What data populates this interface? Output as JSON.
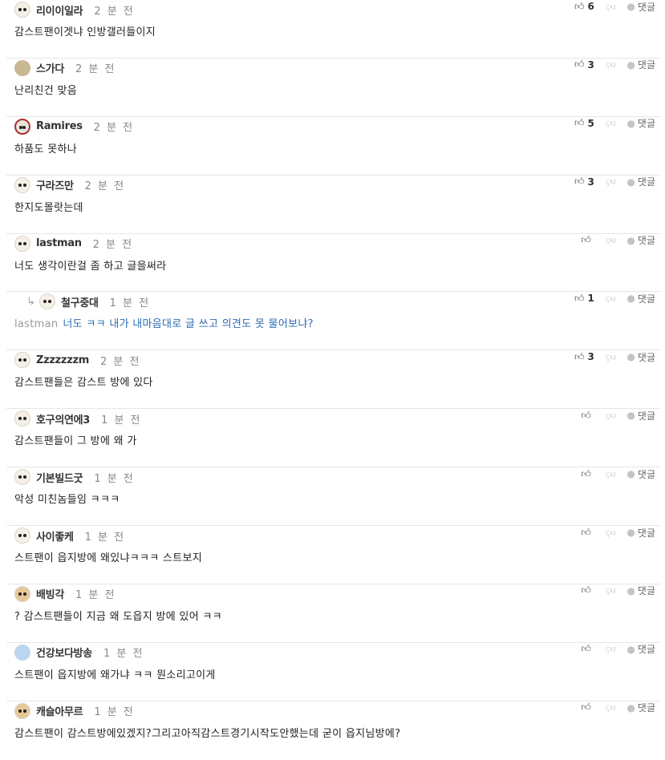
{
  "comments": [
    {
      "nick": "리이이일라",
      "time": "2 분 전",
      "text": "감스트팬이겟냐 인방갤러들이지",
      "likes": "6",
      "avatar": "dog-icon"
    },
    {
      "nick": "스가다",
      "time": "2 분 전",
      "text": "난리친건 맞음",
      "likes": "3",
      "avatar": "blob-icon"
    },
    {
      "nick": "Ramires",
      "time": "2 분 전",
      "text": "하품도 못하나",
      "likes": "5",
      "avatar": "red-dog-icon"
    },
    {
      "nick": "구라즈만",
      "time": "2 분 전",
      "text": "한지도몰랏는데",
      "likes": "3",
      "avatar": "dog-icon"
    },
    {
      "nick": "lastman",
      "time": "2 분 전",
      "text": "너도 생각이란걸 좀 하고 글을써라",
      "likes": "",
      "avatar": "dog-icon"
    },
    {
      "nick": "철구중대",
      "time": "1 분 전",
      "mention": "lastman",
      "text": "너도 ㅋㅋ 내가 내마음대로 글 쓰고 의견도 못 물어보냐?",
      "likes": "1",
      "avatar": "dog-icon",
      "reply": true
    },
    {
      "nick": "Zzzzzzzm",
      "time": "2 분 전",
      "text": "감스트팬들은 감스트 방에 있다",
      "likes": "3",
      "avatar": "dog-icon"
    },
    {
      "nick": "호구의연에3",
      "time": "1 분 전",
      "text": "감스트팬들이 그 방에 왜 가",
      "likes": "",
      "avatar": "dog-icon"
    },
    {
      "nick": "기본빌드굿",
      "time": "1 분 전",
      "text": "악성 미친놈들임 ㅋㅋㅋ",
      "likes": "",
      "avatar": "dog-icon"
    },
    {
      "nick": "사이좋케",
      "time": "1 분 전",
      "text": "스트팬이 읍지방에 왜있냐ㅋㅋㅋ 스트보지",
      "likes": "",
      "avatar": "dog-icon"
    },
    {
      "nick": "배빙각",
      "time": "1 분 전",
      "text": "? 감스트팬들이 지금 왜 도읍지 방에 있어 ㅋㅋ",
      "likes": "",
      "avatar": "fox-icon"
    },
    {
      "nick": "건강보다방송",
      "time": "1 분 전",
      "text": "스트팬이 읍지방에 왜가냐 ㅋㅋ 뭔소리고이게",
      "likes": "",
      "avatar": "blue-avatar-icon"
    },
    {
      "nick": "캐슬아무르",
      "time": "1 분 전",
      "text": "감스트팬이 감스트방에있겠지?그리고아직감스트경기시작도안했는데 굳이 읍지님방에?",
      "likes": "",
      "avatar": "fox-icon"
    }
  ],
  "labels": {
    "reply": "댓글"
  },
  "icons": {
    "like": "thumb-up-icon",
    "dislike": "thumb-down-icon",
    "reply": "speech-bubble-icon",
    "reply_arrow": "reply-arrow-icon"
  }
}
